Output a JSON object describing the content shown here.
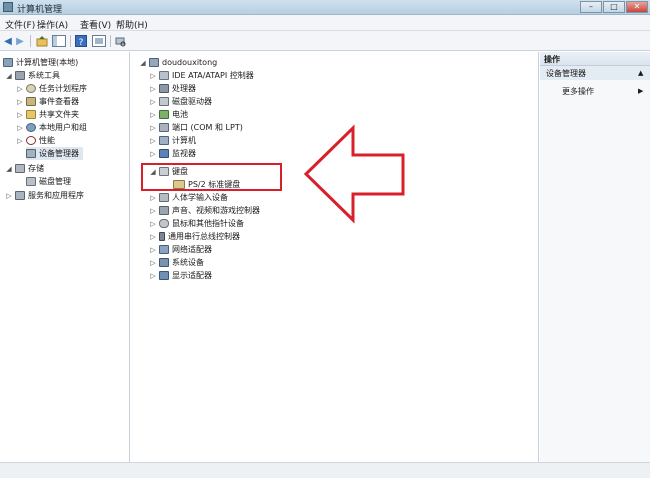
{
  "window": {
    "title": "计算机管理"
  },
  "menubar": {
    "file": "文件(F)",
    "action": "操作(A)",
    "view": "查看(V)",
    "help": "帮助(H)"
  },
  "toolbar": {
    "buttons": [
      "back-icon",
      "forward-icon",
      "up-icon",
      "show-hide-tree-icon",
      "help-icon",
      "properties-icon",
      "scan-icon"
    ]
  },
  "left_tree": {
    "root": "计算机管理(本地)",
    "system_tools": "系统工具",
    "task_scheduler": "任务计划程序",
    "event_viewer": "事件查看器",
    "shared_folders": "共享文件夹",
    "local_users": "本地用户和组",
    "performance": "性能",
    "device_manager": "设备管理器",
    "storage": "存储",
    "disk_management": "磁盘管理",
    "services": "服务和应用程序"
  },
  "device_tree": {
    "computer": "doudouxitong",
    "items": [
      "IDE ATA/ATAPI 控制器",
      "处理器",
      "磁盘驱动器",
      "电池",
      "端口 (COM 和 LPT)",
      "计算机",
      "监视器",
      "键盘",
      "PS/2 标准键盘",
      "人体学输入设备",
      "声音、视频和游戏控制器",
      "鼠标和其他指针设备",
      "通用串行总线控制器",
      "网络适配器",
      "系统设备",
      "显示适配器"
    ]
  },
  "actions_pane": {
    "header": "操作",
    "section": "设备管理器",
    "more": "更多操作"
  },
  "colors": {
    "annotation_red": "#d9202a",
    "selection": "#dfe7f1"
  }
}
